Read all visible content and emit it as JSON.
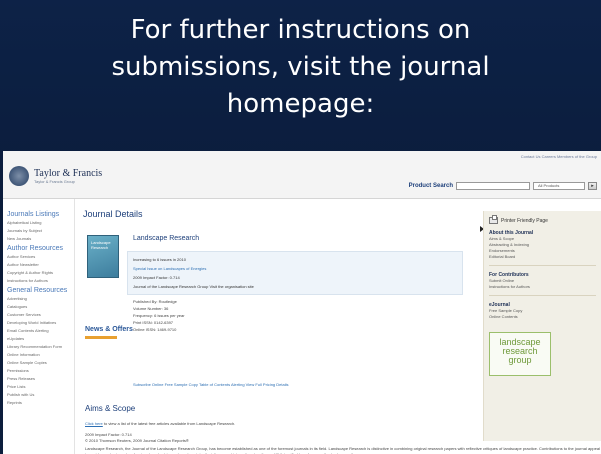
{
  "slide": {
    "headline_lines": [
      "For further instructions on",
      "submissions, visit the journal",
      "homepage:"
    ]
  },
  "site": {
    "logo_name": "Taylor & Francis",
    "logo_sub": "Taylor & Francis Group",
    "top_links": "Contact Us  Careers  Members of the Group",
    "search_label": "Product Search",
    "search_scope": "All Products"
  },
  "nav": {
    "sections": [
      {
        "head": "Journals Listings",
        "items": [
          "Alphabetical Listing",
          "Journals by Subject",
          "New Journals"
        ]
      },
      {
        "head": "Author Resources",
        "items": [
          "Author Services",
          "Author Newsletter",
          "Copyright & Author Rights",
          "Instructions for Authors"
        ]
      },
      {
        "head": "General Resources",
        "items": [
          "Advertising",
          "Catalogues",
          "Customer Services",
          "Developing World Initiatives",
          "Email Contents Alerting",
          "eUpdates",
          "Library Recommendation Form",
          "Online Information",
          "Online Sample Copies",
          "Permissions",
          "Press Releases",
          "Price Lists",
          "Publish with Us",
          "Reprints"
        ]
      }
    ]
  },
  "main": {
    "page_title": "Journal Details",
    "cover_title": "Landscape Research",
    "journal_title": "Landscape Research",
    "news_label": "News & Offers",
    "info_lines": [
      "Increasing to 6 issues in 2010",
      "Special Issue on Landscapes of Energies",
      "2009 Impact Factor: 0.714",
      "Journal of the Landscape Research Group  Visit the organisation site"
    ],
    "pub_lines": [
      "Published By: Routledge",
      "Volume Number: 36",
      "Frequency: 6 issues per year",
      "Print ISSN: 0142-6397",
      "Online ISSN: 1469-9710"
    ],
    "links": "Subscribe Online   Free Sample Copy   Table of Contents Alerting   View Full Pricing Details",
    "aims_title": "Aims & Scope",
    "aims_link": "Click here",
    "aims_rest": " to view a list of the latest free articles available from Landscape Research.",
    "impact_line": "2009 Impact Factor: 0.714",
    "impact_source": "© 2010 Thomson Reuters, 2009 Journal Citation Reports®",
    "paragraph": "Landscape Research, the Journal of the Landscape Research Group, has become established as one of the foremost journals in its field. Landscape Research is distinctive in combining original research papers with reflective critiques of landscape practice. Contributions to the journal appeal to a wide academic and professional readership, and reach an interdisciplinary and international audience. Whilst unified by a focus on the landscape, the"
  },
  "right": {
    "printer_label": "Printer Friendly Page",
    "about_head": "About this Journal",
    "about_items": [
      "Aims & Scope",
      "Abstracting & Indexing",
      "Endorsements",
      "Editorial Board"
    ],
    "contrib_head": "For Contributors",
    "contrib_items": [
      "Submit Online",
      "Instructions for Authors"
    ],
    "ejournal_head": "eJournal",
    "ejournal_items": [
      "Free Sample Copy",
      "Online Contents"
    ],
    "badge_lines": [
      "landscape",
      "research",
      "group"
    ]
  }
}
